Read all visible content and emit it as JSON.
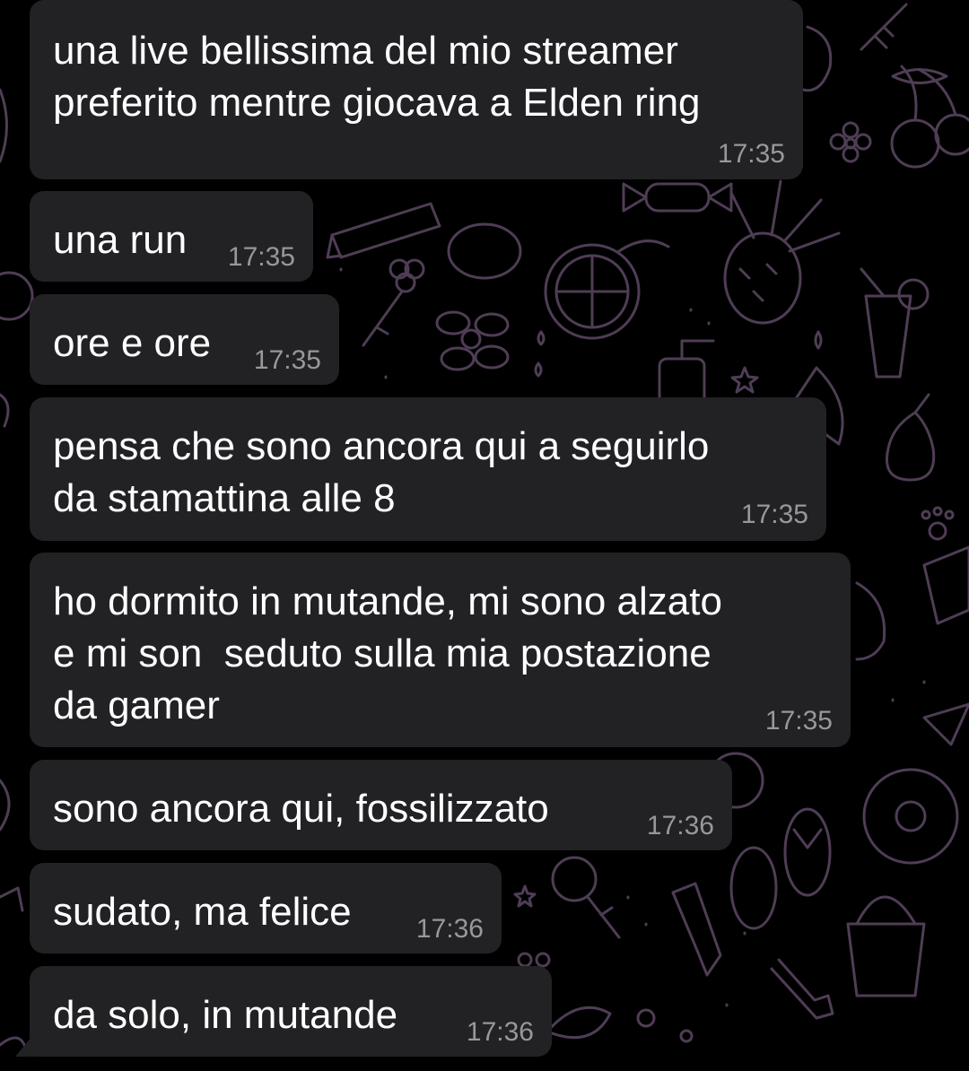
{
  "theme": {
    "background": "#000000",
    "bubble_color": "#222124",
    "text_color": "#ffffff",
    "time_color": "#98979c",
    "doodle_color": "#5a4660"
  },
  "messages": [
    {
      "text": "una live bellissima del mio streamer\npreferito mentre giocava a Elden ring",
      "time": "17:35"
    },
    {
      "text": "una run",
      "time": "17:35"
    },
    {
      "text": "ore e ore",
      "time": "17:35"
    },
    {
      "text": "pensa che sono ancora qui a seguirlo\nda stamattina alle 8",
      "time": "17:35"
    },
    {
      "text": "ho dormito in mutande, mi sono alzato\ne mi son  seduto sulla mia postazione\nda gamer",
      "time": "17:35"
    },
    {
      "text": "sono ancora qui, fossilizzato",
      "time": "17:36"
    },
    {
      "text": "sudato, ma felice",
      "time": "17:36"
    },
    {
      "text": "da solo, in mutande",
      "time": "17:36"
    }
  ],
  "wallpaper_icons": [
    "key-icon",
    "cherries-icon",
    "flower-icon",
    "pineapple-icon",
    "pencil-icon",
    "candy-icon",
    "lemon-icon",
    "orange-slice-icon",
    "cocktail-icon",
    "soap-bottle-icon",
    "star-icon",
    "watermelon-icon",
    "pear-icon",
    "paw-icon",
    "bread-icon",
    "donut-icon",
    "flip-flops-icon",
    "crayon-icon",
    "bucket-icon",
    "shovel-icon",
    "ice-cream-icon"
  ]
}
